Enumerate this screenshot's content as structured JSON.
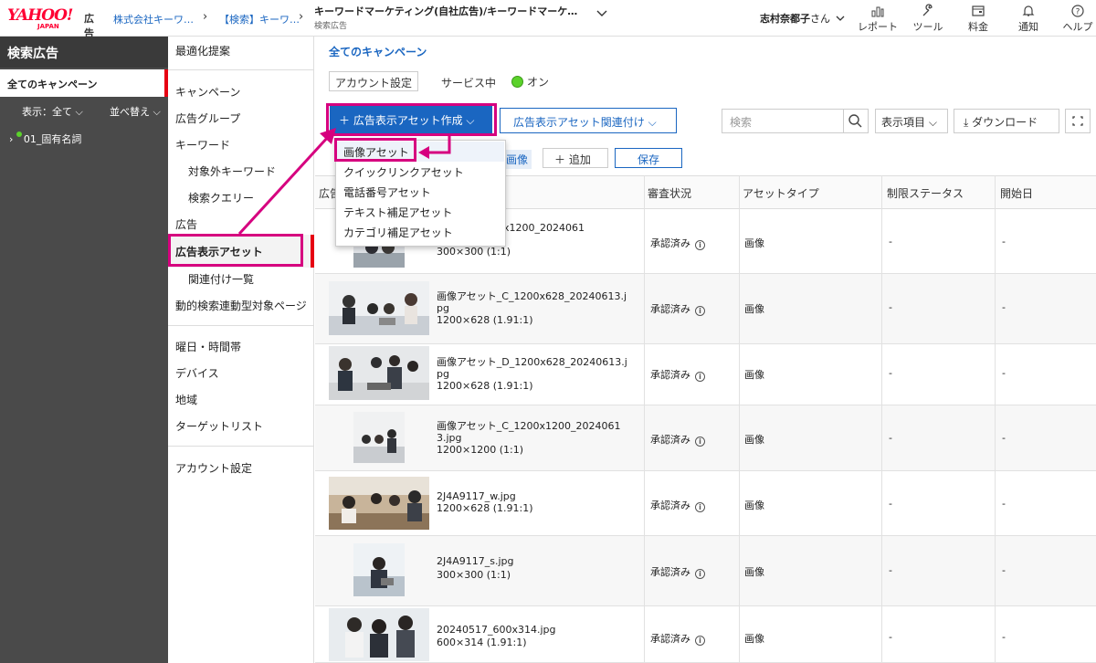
{
  "header": {
    "logo_text": "YAHOO!",
    "logo_sub": "JAPAN",
    "logo_product": "広告",
    "breadcrumb_company": "株式会社キーワ…",
    "breadcrumb_account": "【検索】キーワ…",
    "account_name": "キーワードマーケティング(自社広告)/キーワードマーケ…",
    "account_type": "検索広告",
    "user_name": "志村奈都子",
    "user_suffix": "さん",
    "icons": [
      {
        "name": "report-icon",
        "label": "レポート"
      },
      {
        "name": "tool-icon",
        "label": "ツール"
      },
      {
        "name": "billing-icon",
        "label": "料金"
      },
      {
        "name": "bell-icon",
        "label": "通知"
      },
      {
        "name": "help-icon",
        "label": "ヘルプ"
      }
    ]
  },
  "sidebar": {
    "title": "検索広告",
    "selected": "全てのキャンペーン",
    "display_option": "表示：全て",
    "sort_option": "並べ替え",
    "campaign": "01_固有名詞"
  },
  "nav": {
    "optimize": "最適化提案",
    "campaign": "キャンペーン",
    "adgroup": "広告グループ",
    "keyword": "キーワード",
    "negative_keyword": "対象外キーワード",
    "search_query": "検索クエリー",
    "ads": "広告",
    "assets": "広告表示アセット",
    "association_list": "関連付け一覧",
    "dynamic_pages": "動的検索連動型対象ページ",
    "schedule": "曜日・時間帯",
    "device": "デバイス",
    "region": "地域",
    "target_list": "ターゲットリスト",
    "account_settings": "アカウント設定"
  },
  "main": {
    "title": "全てのキャンペーン",
    "account_settings_btn": "アカウント設定",
    "service_label": "サービス中",
    "on_label": "オン",
    "create_btn": "広告表示アセット作成",
    "associate_btn": "広告表示アセット関連付け",
    "search_placeholder": "検索",
    "columns_btn": "表示項目",
    "download_btn": "ダウンロード",
    "filter_chip": "画像",
    "add_btn": "追加",
    "save_btn": "保存"
  },
  "dropdown": {
    "items": [
      "画像アセット",
      "クイックリンクアセット",
      "電話番号アセット",
      "テキスト補足アセット",
      "カテゴリ補足アセット"
    ]
  },
  "table": {
    "headers": [
      "広告",
      "審査状況",
      "アセットタイプ",
      "制限ステータス",
      "開始日"
    ],
    "rows": [
      {
        "name": "D_1200x1200_2024061",
        "size": "300×300 (1:1)",
        "status": "承認済み",
        "type": "画像",
        "limit": "-",
        "start": "-"
      },
      {
        "name": "画像アセット_C_1200x628_20240613.j\npg",
        "size": "1200×628 (1.91:1)",
        "status": "承認済み",
        "type": "画像",
        "limit": "-",
        "start": "-"
      },
      {
        "name": "画像アセット_D_1200x628_20240613.j\npg",
        "size": "1200×628 (1.91:1)",
        "status": "承認済み",
        "type": "画像",
        "limit": "-",
        "start": "-"
      },
      {
        "name": "画像アセット_C_1200x1200_2024061\n3.jpg",
        "size": "1200×1200 (1:1)",
        "status": "承認済み",
        "type": "画像",
        "limit": "-",
        "start": "-"
      },
      {
        "name": "2J4A9117_w.jpg",
        "size": "1200×628 (1.91:1)",
        "status": "承認済み",
        "type": "画像",
        "limit": "-",
        "start": "-"
      },
      {
        "name": "2J4A9117_s.jpg",
        "size": "300×300 (1:1)",
        "status": "承認済み",
        "type": "画像",
        "limit": "-",
        "start": "-"
      },
      {
        "name": "20240517_600x314.jpg",
        "size": "600×314 (1.91:1)",
        "status": "承認済み",
        "type": "画像",
        "limit": "-",
        "start": "-"
      }
    ]
  },
  "colors": {
    "accent": "#1a66c1",
    "highlight": "#d6007f",
    "active_marker": "#e60012",
    "on_dot": "#5bd22b"
  }
}
